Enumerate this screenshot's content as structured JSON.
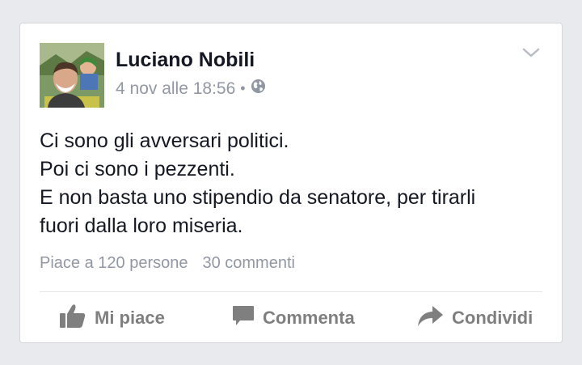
{
  "post": {
    "author": "Luciano Nobili",
    "timestamp": "4 nov alle 18:56",
    "separator": "•",
    "privacy_icon": "globe-icon",
    "lines": [
      "Ci sono gli avversari politici.",
      "Poi ci sono i pezzenti.",
      "E non basta uno stipendio da senatore, per tirarli",
      "fuori dalla loro miseria."
    ],
    "likes": "Piace a 120 persone",
    "comments": "30 commenti"
  },
  "actions": {
    "like": "Mi piace",
    "comment": "Commenta",
    "share": "Condividi"
  },
  "colors": {
    "background": "#e9eaed",
    "text": "#141823",
    "meta": "#9197a3",
    "action": "#7f7f7f"
  }
}
